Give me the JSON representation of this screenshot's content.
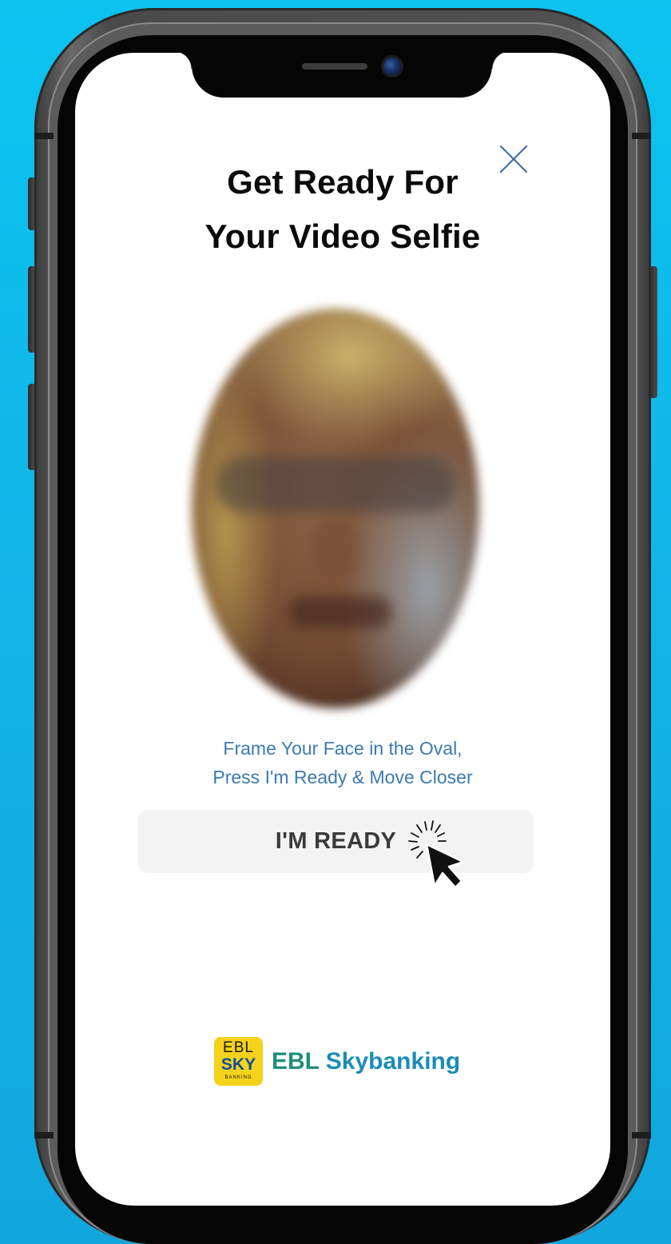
{
  "screen": {
    "title_line1": "Get Ready For",
    "title_line2": "Your Video Selfie",
    "close_icon": "close-icon",
    "hint_line1": "Frame Your Face in the Oval,",
    "hint_line2": "Press I'm Ready & Move Closer",
    "ready_button_label": "I'M READY"
  },
  "brand": {
    "logo_top": "EBL",
    "logo_middle": "SKY",
    "logo_bottom": "BANKING",
    "name_part1": "EBL",
    "name_part2": "Skybanking"
  },
  "colors": {
    "background": "#12b2e6",
    "hint_text": "#3b7ab1",
    "button_bg": "#f3f3f3",
    "logo_yellow": "#f5d21b",
    "brand_green": "#1f8f7c",
    "brand_blue": "#1a8db5"
  },
  "icons": [
    "close-icon",
    "pointer-cursor-icon",
    "camera-icon"
  ]
}
